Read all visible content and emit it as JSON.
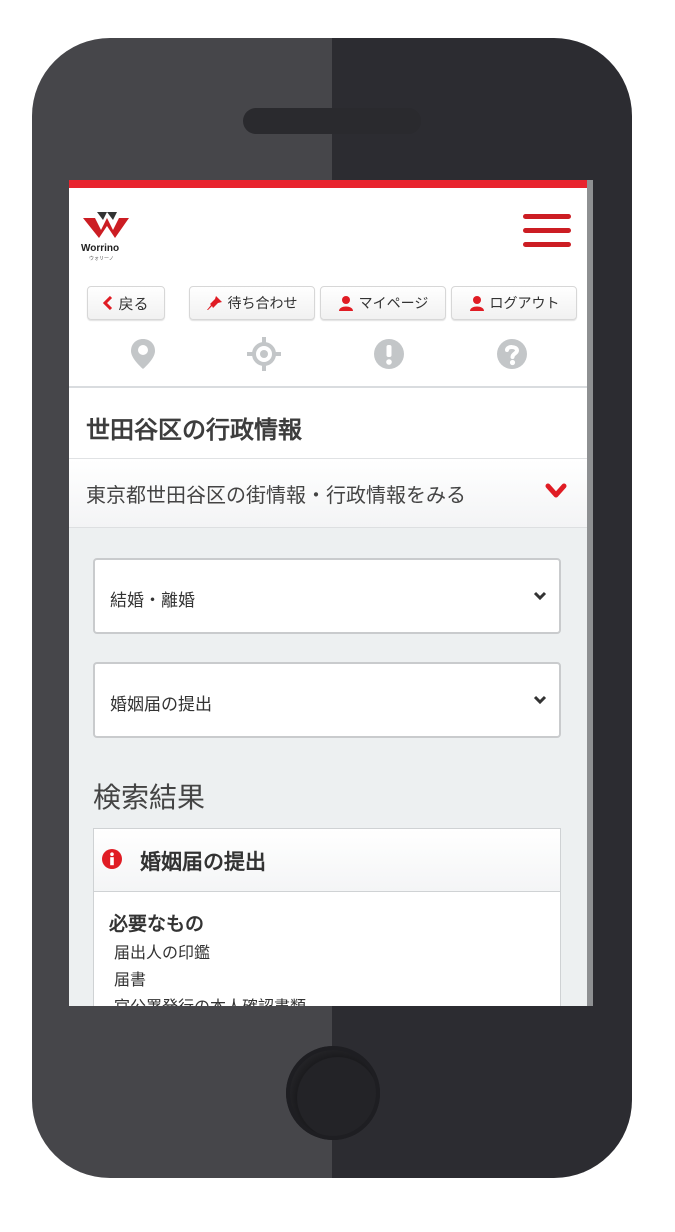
{
  "app": {
    "logo_text": "Worrino",
    "logo_subtext": "ウォリーノ"
  },
  "toolbar": {
    "back_label": "戻る",
    "meetup_label": "待ち合わせ",
    "mypage_label": "マイページ",
    "logout_label": "ログアウト"
  },
  "nav_icons": [
    "location-pin-icon",
    "crosshair-icon",
    "alert-icon",
    "help-icon"
  ],
  "page": {
    "title": "世田谷区の行政情報",
    "city_link": "東京都世田谷区の街情報・行政情報をみる"
  },
  "filters": {
    "category_value": "結婚・離婚",
    "subcategory_value": "婚姻届の提出"
  },
  "results": {
    "heading": "検索結果",
    "card_title": "婚姻届の提出",
    "requirements_title": "必要なもの",
    "requirements": [
      "届出人の印鑑",
      "届書",
      "官公署発行の本人確認書類"
    ]
  },
  "colors": {
    "accent": "#e8242e",
    "menu": "#cc1d23",
    "phone_left": "#46464a",
    "phone_right": "#2c2c31",
    "nav_icon": "#c3c6c8"
  }
}
